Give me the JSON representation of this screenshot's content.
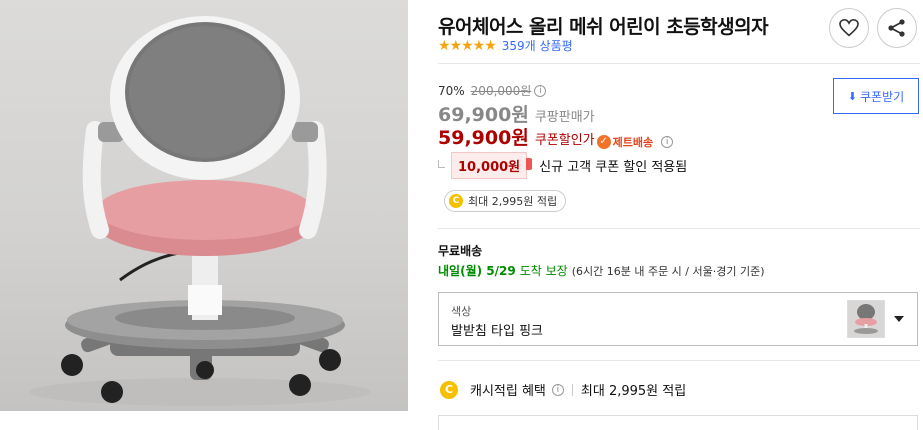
{
  "product": {
    "title": "유어체어스 올리 메쉬 어린이 초등학생의자",
    "stars": "★★★★★",
    "rating": 4.5,
    "review_count": "359개 상품평"
  },
  "icons": {
    "wishlist": "heart-icon",
    "share": "share-icon"
  },
  "pricing": {
    "discount_rate": "70%",
    "original_price": "200,000원",
    "sale_price": "69,900원",
    "sale_label": "쿠팡판매가",
    "coupon_price": "59,900원",
    "coupon_label": "쿠폰할인가",
    "jet_delivery": "제트배송",
    "coupon_button": "쿠폰받기"
  },
  "new_coupon": {
    "amount": "10,000원",
    "text": "신규 고객 쿠폰 할인 적용됨"
  },
  "points": {
    "coin": "C",
    "text": "최대 2,995원 적립"
  },
  "shipping": {
    "title": "무료배송",
    "arrival": "내일(월) 5/29",
    "guarantee": "도착 보장",
    "cutoff": "(6시간 16분  내 주문 시 / 서울·경기 기준)"
  },
  "option": {
    "label": "색상",
    "value": "발받침 타입 핑크"
  },
  "cash": {
    "coin": "C",
    "label": "캐시적립 혜택",
    "value": "최대 2,995원 적립"
  },
  "colors": {
    "coupon_red": "#ae0000",
    "link_blue": "#346aff",
    "green": "#008c00",
    "star": "#f2a413"
  }
}
